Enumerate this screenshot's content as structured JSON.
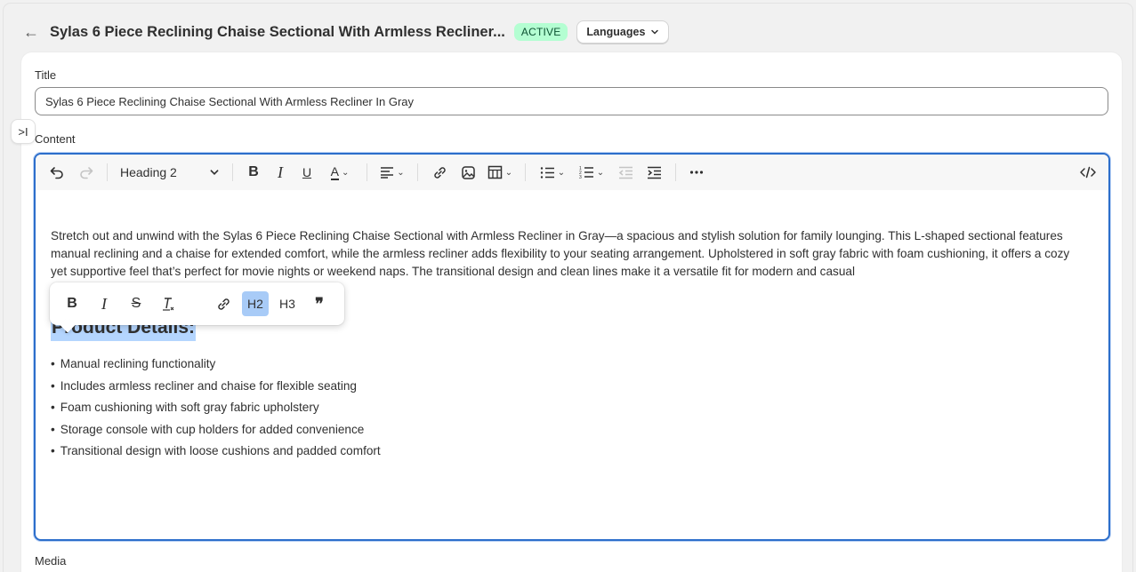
{
  "header": {
    "back_label": "←",
    "title": "Sylas 6 Piece Reclining Chaise Sectional With Armless Recliner...",
    "status": "ACTIVE",
    "languages_label": "Languages",
    "status_color": "#b4fed2"
  },
  "form": {
    "title_label": "Title",
    "title_value": "Sylas 6 Piece Reclining Chaise Sectional With Armless Recliner In Gray",
    "content_label": "Content",
    "media_label": "Media",
    "collapse_label": ">I"
  },
  "toolbar": {
    "heading_value": "Heading 2",
    "icons": [
      "undo-icon",
      "redo-icon",
      "bold-icon",
      "italic-icon",
      "underline-icon",
      "text-color-icon",
      "align-icon",
      "link-icon",
      "image-icon",
      "table-icon",
      "bullet-list-icon",
      "numbered-list-icon",
      "outdent-icon",
      "indent-icon",
      "more-icon",
      "code-view-icon"
    ]
  },
  "editor": {
    "paragraph": "Stretch out and unwind with the Sylas 6 Piece Reclining Chaise Sectional with Armless Recliner in Gray—a spacious and stylish solution for family lounging. This L-shaped sectional features manual reclining and a chaise for extended comfort, while the armless recliner adds flexibility to your seating arrangement. Upholstered in soft gray fabric with foam cushioning, it offers a cozy yet supportive feel that’s perfect for movie nights or weekend naps. The transitional design and clean lines make it a versatile fit for modern and casual",
    "heading": "Product Details:",
    "bullets": [
      "Manual reclining functionality",
      "Includes armless recliner and chaise for flexible seating",
      "Foam cushioning with soft gray fabric upholstery",
      "Storage console with cup holders for added convenience",
      "Transitional design with loose cushions and padded comfort"
    ]
  },
  "bubble_menu": {
    "bold": "B",
    "italic": "I",
    "strike": "S",
    "clear": "Tx",
    "h2": "H2",
    "h3": "H3",
    "quote": "❞",
    "active_color": "#a8cbf7"
  }
}
